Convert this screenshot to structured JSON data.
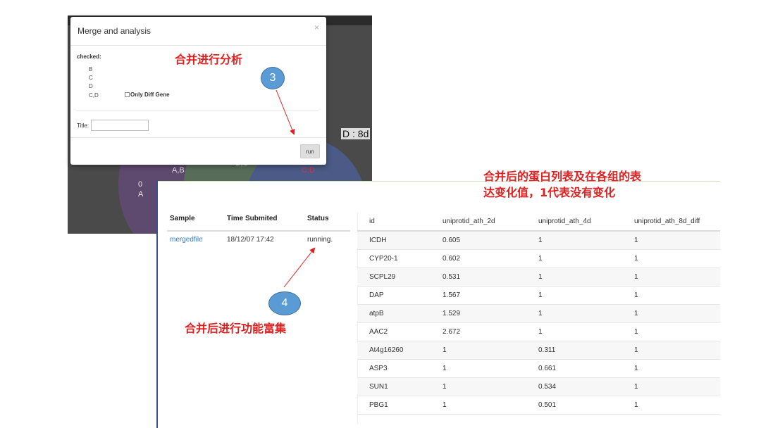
{
  "background": {
    "venn_d_label": "D : 8d",
    "region_ab": "A,B",
    "region_cd": "C,D",
    "region_bc": "B,C",
    "count_zero": "0",
    "set_a": "A"
  },
  "modal": {
    "title": "Merge and analysis",
    "close": "×",
    "checked_label": "checked:",
    "groups": [
      "B",
      "C",
      "D",
      "C,D"
    ],
    "only_diff_label": "Only Diff Gene",
    "title_field_label": "Title:",
    "title_value": "",
    "run_label": "run"
  },
  "annotations": {
    "merge": "合并进行分析",
    "step3": "3",
    "step4": "4",
    "enrich": "合并后进行功能富集",
    "table_line1": "合并后的蛋白列表及在各组的表",
    "table_line2": "达变化值，1代表没有变化"
  },
  "colors": {
    "annotation_red": "#e02020",
    "step_circle": "#5b9bd5",
    "link_blue": "#3a7bbf"
  },
  "sample_table": {
    "headers": [
      "Sample",
      "Time Submited",
      "Status"
    ],
    "row": {
      "sample": "mergedfile",
      "time": "18/12/07 17:42",
      "status": "running."
    }
  },
  "data_table": {
    "headers": [
      "id",
      "uniprotid_ath_2d",
      "uniprotid_ath_4d",
      "uniprotid_ath_8d_diff"
    ],
    "rows": [
      [
        "ICDH",
        "0.605",
        "1",
        "1"
      ],
      [
        "CYP20-1",
        "0.602",
        "1",
        "1"
      ],
      [
        "SCPL29",
        "0.531",
        "1",
        "1"
      ],
      [
        "DAP",
        "1.567",
        "1",
        "1"
      ],
      [
        "atpB",
        "1.529",
        "1",
        "1"
      ],
      [
        "AAC2",
        "2.672",
        "1",
        "1"
      ],
      [
        "At4g16260",
        "1",
        "0.311",
        "1"
      ],
      [
        "ASP3",
        "1",
        "0.661",
        "1"
      ],
      [
        "SUN1",
        "1",
        "0.534",
        "1"
      ],
      [
        "PBG1",
        "1",
        "0.501",
        "1"
      ]
    ]
  }
}
